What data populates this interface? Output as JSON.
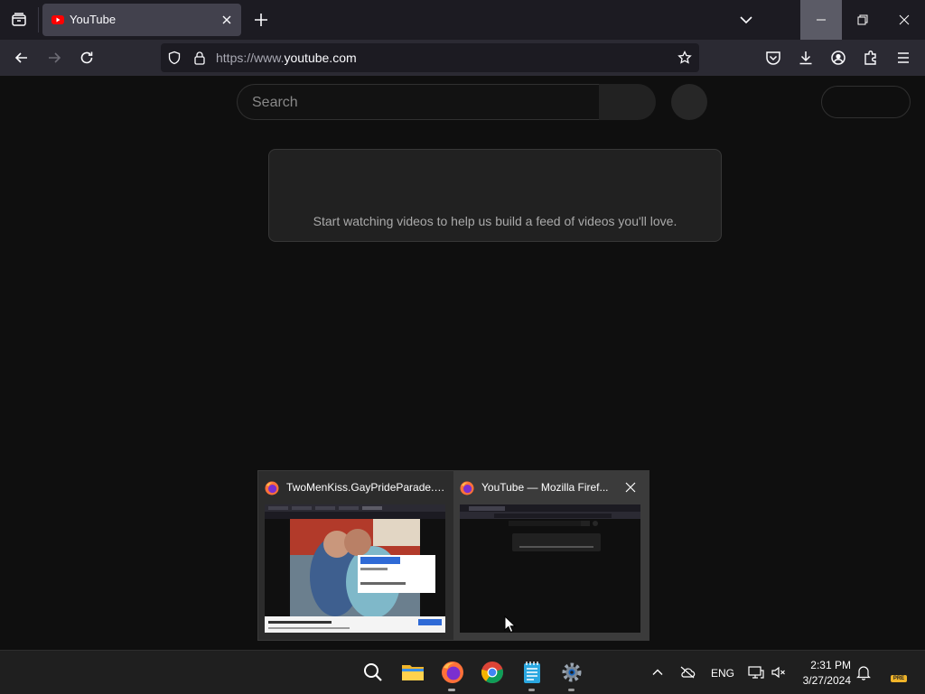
{
  "browser": {
    "tab": {
      "title": "YouTube"
    },
    "url": {
      "scheme": "https://",
      "prefix": "www.",
      "host": "youtube.com"
    }
  },
  "youtube": {
    "search_placeholder": "Search",
    "feed_message": "Start watching videos to help us build a feed of videos you'll love."
  },
  "taskbar_preview": {
    "items": [
      {
        "title": "TwoMenKiss.GayPrideParade.W..."
      },
      {
        "title": "YouTube — Mozilla Firef..."
      }
    ]
  },
  "taskbar": {
    "language": "ENG",
    "time": "2:31 PM",
    "date": "3/27/2024",
    "badge": "PRE"
  },
  "colors": {
    "firefox_chrome": "#1c1b22",
    "toolbar": "#2b2a33",
    "youtube_bg": "#0f0f0f",
    "youtube_red": "#ff0000",
    "taskbar": "#1f1f1f"
  }
}
